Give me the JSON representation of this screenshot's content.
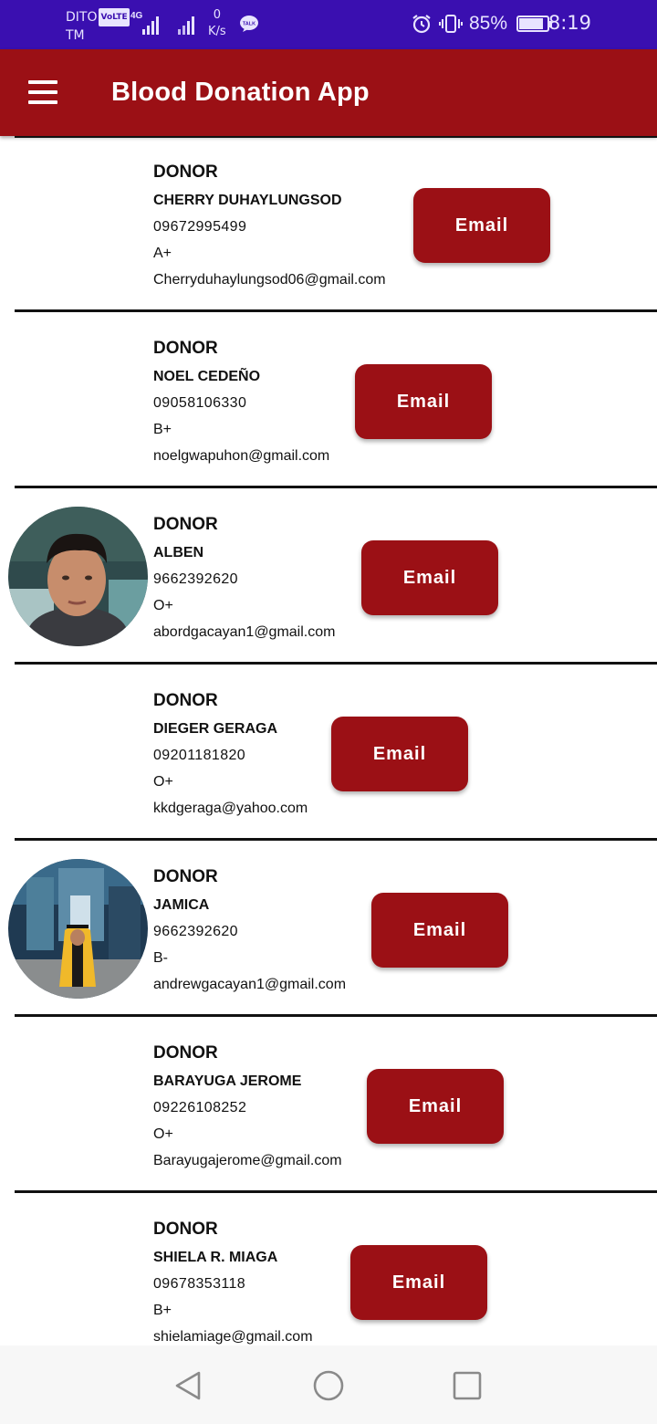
{
  "status_bar": {
    "carrier": "DITO",
    "volte": "VoLTE",
    "carrier_suffix": "TM",
    "network": "4G",
    "speed_value": "0",
    "speed_unit": "K/s",
    "talk_icon_text": "TALK",
    "battery": "85%",
    "battery_level": 0.85,
    "time": "8:19",
    "icons": [
      "alarm-icon",
      "vibrate-icon",
      "battery-icon",
      "signal-icon",
      "talk-icon"
    ]
  },
  "app_bar": {
    "title": "Blood Donation App",
    "menu_icon": "hamburger-menu-icon"
  },
  "donors": [
    {
      "heading": "DONOR",
      "name": "CHERRY DUHAYLUNGSOD",
      "phone": "09672995499",
      "blood_type": "A+",
      "email": "Cherryduhaylungsod06@gmail.com",
      "button_label": "Email",
      "has_photo": false
    },
    {
      "heading": "DONOR",
      "name": "NOEL CEDEÑO",
      "phone": "09058106330",
      "blood_type": "B+",
      "email": "noelgwapuhon@gmail.com",
      "button_label": "Email",
      "has_photo": false
    },
    {
      "heading": "DONOR",
      "name": "ALBEN",
      "phone": "9662392620",
      "blood_type": "O+",
      "email": "abordgacayan1@gmail.com",
      "button_label": "Email",
      "has_photo": true
    },
    {
      "heading": "DONOR",
      "name": "DIEGER GERAGA",
      "phone": "09201181820",
      "blood_type": "O+",
      "email": "kkdgeraga@yahoo.com",
      "button_label": "Email",
      "has_photo": false
    },
    {
      "heading": "DONOR",
      "name": "JAMICA",
      "phone": "9662392620",
      "blood_type": "B-",
      "email": "andrewgacayan1@gmail.com",
      "button_label": "Email",
      "has_photo": true
    },
    {
      "heading": "DONOR",
      "name": "BARAYUGA JEROME",
      "phone": "09226108252",
      "blood_type": "O+",
      "email": "Barayugajerome@gmail.com",
      "button_label": "Email",
      "has_photo": false
    },
    {
      "heading": "DONOR",
      "name": "SHIELA R. MIAGA",
      "phone": "09678353118",
      "blood_type": "B+",
      "email": "shielamiage@gmail.com",
      "button_label": "Email",
      "has_photo": false
    }
  ],
  "colors": {
    "status_bar": "#3a0fb0",
    "primary": "#9b1015",
    "button_text": "#ffffff",
    "background": "#ffffff"
  },
  "nav_bar": {
    "back_icon": "back-triangle-icon",
    "home_icon": "home-circle-icon",
    "recents_icon": "recents-square-icon"
  }
}
